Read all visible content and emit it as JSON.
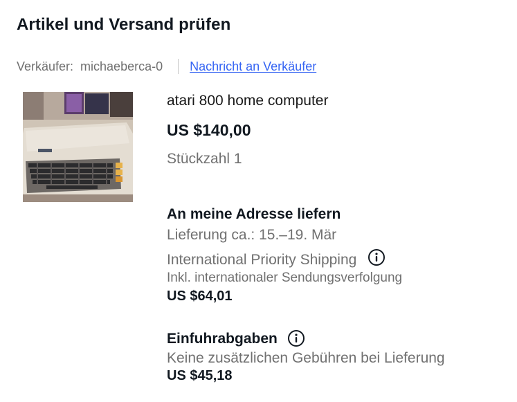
{
  "heading": "Artikel und Versand prüfen",
  "seller": {
    "label": "Verkäufer:",
    "name": "michaeberca-0",
    "contact_link": "Nachricht an Verkäufer"
  },
  "item": {
    "image_icon": "product-photo-atari-800",
    "title": "atari 800 home computer",
    "price": "US $140,00",
    "quantity": "Stückzahl 1"
  },
  "shipping": {
    "title": "An meine Adresse liefern",
    "delivery": "Lieferung ca.: 15.–19. Mär",
    "service": "International Priority Shipping",
    "service_info_icon": "info-icon",
    "tracking": "Inkl. internationaler Sendungsverfolgung",
    "cost": "US $64,01"
  },
  "import_charges": {
    "title": "Einfuhrabgaben",
    "info_icon": "info-icon",
    "note": "Keine zusätzlichen Gebühren bei Lieferung",
    "cost": "US $45,18"
  },
  "colors": {
    "link": "#3665f3",
    "secondary_text": "#707070",
    "primary_text": "#111820"
  }
}
